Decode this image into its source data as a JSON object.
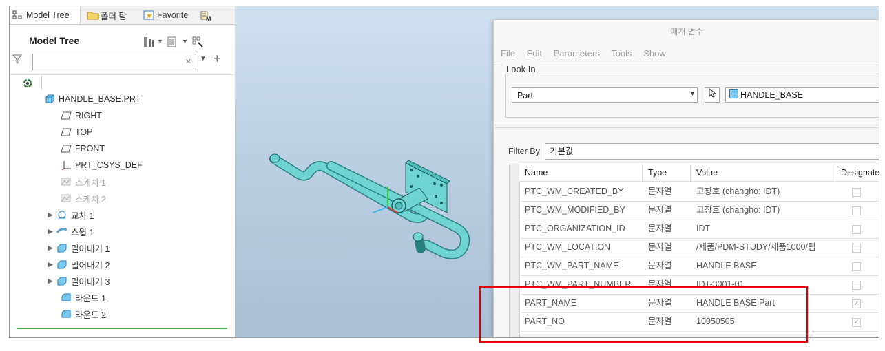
{
  "tabs": [
    {
      "label": "Model Tree"
    },
    {
      "label": "폴더 탐"
    },
    {
      "label": "Favorite"
    }
  ],
  "model_tree": {
    "title": "Model Tree",
    "search_value": "",
    "nodes": [
      {
        "label": "HANDLE_BASE.PRT",
        "icon": "part-icon"
      },
      {
        "label": "RIGHT",
        "icon": "datum-plane-icon"
      },
      {
        "label": "TOP",
        "icon": "datum-plane-icon"
      },
      {
        "label": "FRONT",
        "icon": "datum-plane-icon"
      },
      {
        "label": "PRT_CSYS_DEF",
        "icon": "csys-icon"
      },
      {
        "label": "스케치 1",
        "icon": "sketch-icon"
      },
      {
        "label": "스케치 2",
        "icon": "sketch-icon"
      },
      {
        "label": "교차 1",
        "icon": "intersect-icon"
      },
      {
        "label": "스윕 1",
        "icon": "sweep-icon"
      },
      {
        "label": "밀어내기 1",
        "icon": "extrude-icon"
      },
      {
        "label": "밀어내기 2",
        "icon": "extrude-icon"
      },
      {
        "label": "밀어내기 3",
        "icon": "extrude-icon"
      },
      {
        "label": "라운드 1",
        "icon": "round-icon"
      },
      {
        "label": "라운드 2",
        "icon": "round-icon"
      }
    ]
  },
  "dialog": {
    "title": "매개 변수",
    "menu": [
      "File",
      "Edit",
      "Parameters",
      "Tools",
      "Show"
    ],
    "look_in_label": "Look In",
    "look_in_value": "Part",
    "object_name": "HANDLE_BASE",
    "filter_label": "Filter By",
    "filter_value": "기본값",
    "columns": [
      "Name",
      "Type",
      "Value",
      "Designate"
    ],
    "rows": [
      {
        "name": "PTC_WM_CREATED_BY",
        "type": "문자열",
        "value": "고창호 (changho: IDT)",
        "designated": false
      },
      {
        "name": "PTC_WM_MODIFIED_BY",
        "type": "문자열",
        "value": "고창호 (changho: IDT)",
        "designated": false
      },
      {
        "name": "PTC_ORGANIZATION_ID",
        "type": "문자열",
        "value": "IDT",
        "designated": false
      },
      {
        "name": "PTC_WM_LOCATION",
        "type": "문자열",
        "value": "/제품/PDM-STUDY/제품1000/팀",
        "designated": false
      },
      {
        "name": "PTC_WM_PART_NAME",
        "type": "문자열",
        "value": "HANDLE BASE",
        "designated": false
      },
      {
        "name": "PTC_WM_PART_NUMBER",
        "type": "문자열",
        "value": "IDT-3001-01",
        "designated": false
      },
      {
        "name": "PART_NAME",
        "type": "문자열",
        "value": "HANDLE BASE Part",
        "designated": true
      },
      {
        "name": "PART_NO",
        "type": "문자열",
        "value": "10050505",
        "designated": true
      }
    ]
  },
  "colors": {
    "highlight": "#e00000",
    "model": "#6fd3d3",
    "viewport_bg": "#bcd0e4"
  }
}
